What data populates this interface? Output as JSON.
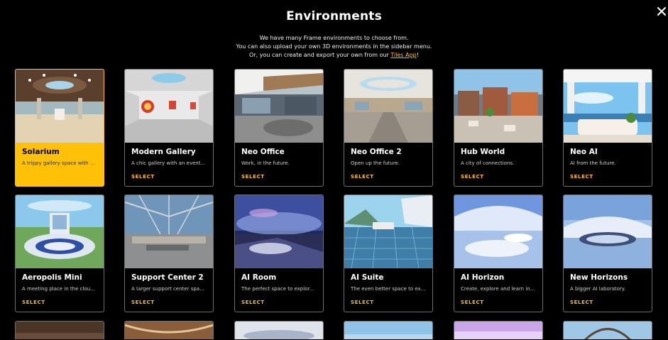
{
  "header": {
    "title": "Environments",
    "desc_line1": "We have many Frame environments to choose from.",
    "desc_line2": "You can also upload your own 3D environments in the sidebar menu.",
    "desc_line3_prefix": "Or, you can create and export your own from our ",
    "desc_link": "Tiles App",
    "desc_line3_suffix": "!",
    "close_icon": "close-icon"
  },
  "select_label": "SELECT",
  "environments": [
    {
      "name": "Solarium",
      "desc": "A trippy gallery space with ...",
      "selected": true
    },
    {
      "name": "Modern Gallery",
      "desc": "A chic gallery with an event..."
    },
    {
      "name": "Neo Office",
      "desc": "Work, in the future."
    },
    {
      "name": "Neo Office 2",
      "desc": "Open up the future."
    },
    {
      "name": "Hub World",
      "desc": "A city of connections."
    },
    {
      "name": "Neo AI",
      "desc": "AI from the future."
    },
    {
      "name": "Aeropolis Mini",
      "desc": "A meeting place in the clou..."
    },
    {
      "name": "Support Center 2",
      "desc": "A larger support center spa..."
    },
    {
      "name": "AI Room",
      "desc": "The perfect space to explor..."
    },
    {
      "name": "AI Suite",
      "desc": "The even better space to ex..."
    },
    {
      "name": "AI Horizon",
      "desc": "Create, explore and learn in..."
    },
    {
      "name": "New Horizons",
      "desc": "A bigger AI laboratory."
    }
  ],
  "colors": {
    "accent": "#ffc107",
    "background": "#000000",
    "card_border": "#6e6e6e"
  }
}
